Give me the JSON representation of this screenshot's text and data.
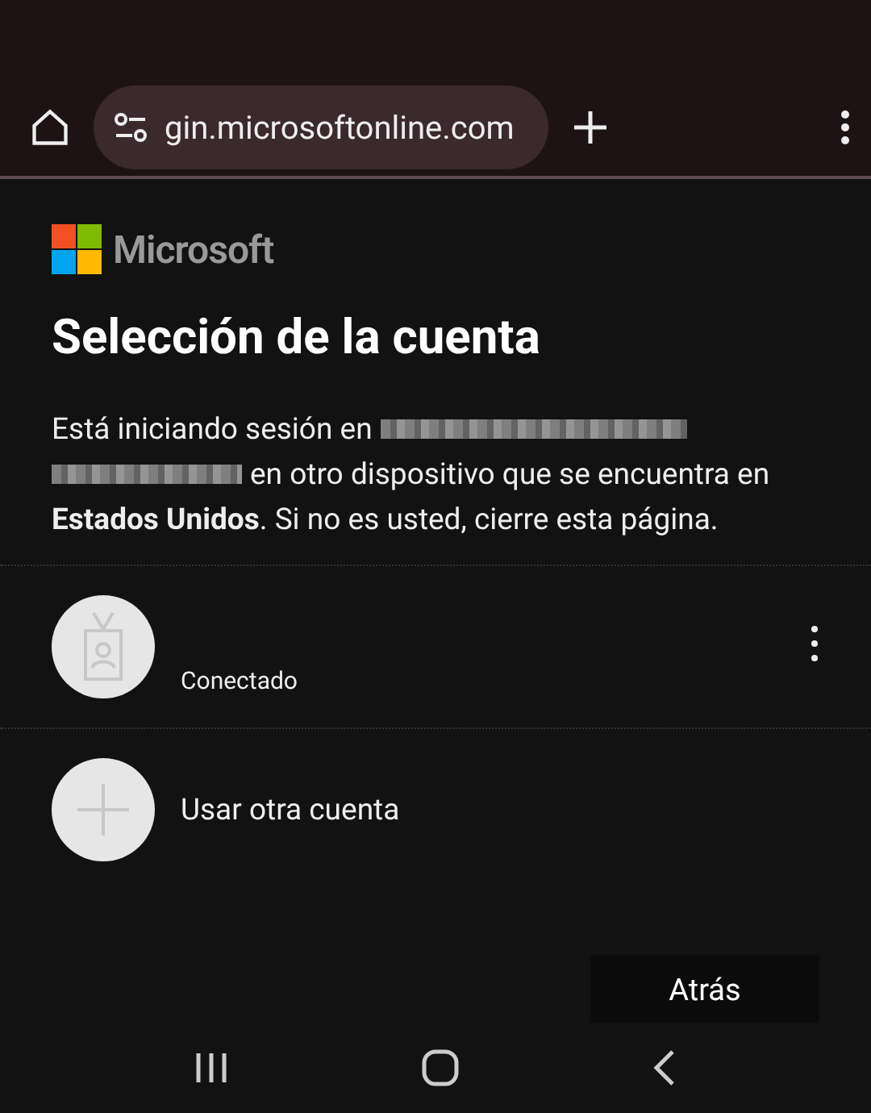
{
  "browser": {
    "url": "gin.microsoftonline.com"
  },
  "brand": {
    "name": "Microsoft"
  },
  "title": "Selección de la cuenta",
  "message": {
    "lead": "Está iniciando sesión en",
    "middle": "en otro dispositivo que se encuentra en",
    "tail": "**Estados Unidos**. Si no es usted, cierre esta página."
  },
  "accounts": [
    {
      "kind": "account",
      "status": "Conectado"
    },
    {
      "kind": "add",
      "label": "Usar otra cuenta"
    }
  ],
  "buttons": [
    {
      "label": "Atrás"
    }
  ]
}
